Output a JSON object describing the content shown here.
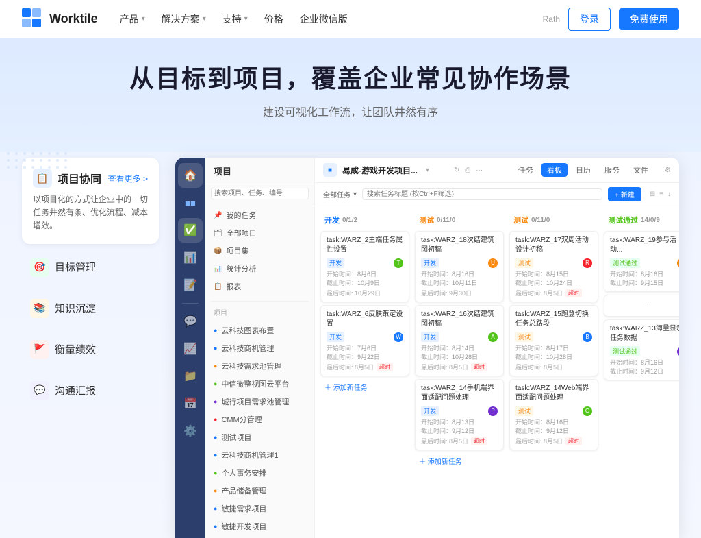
{
  "header": {
    "logo_text": "Worktile",
    "nav": [
      {
        "label": "产品",
        "has_arrow": true
      },
      {
        "label": "解决方案",
        "has_arrow": true
      },
      {
        "label": "支持",
        "has_arrow": true
      },
      {
        "label": "价格",
        "has_arrow": false
      },
      {
        "label": "企业微信版",
        "has_arrow": false
      }
    ],
    "user_email": "Rath",
    "btn_login": "登录",
    "btn_free": "免费使用"
  },
  "hero": {
    "title": "从目标到项目，覆盖企业常见协作场景",
    "subtitle": "建设可视化工作流，让团队井然有序"
  },
  "features": [
    {
      "id": "project",
      "icon": "📋",
      "icon_type": "blue",
      "title": "项目协同",
      "link": "查看更多 >",
      "desc": "以项目化的方式让企业中的一切任务井然有条、优化流程、减本增效。",
      "active": true
    },
    {
      "id": "goal",
      "icon": "🎯",
      "icon_type": "green",
      "title": "目标管理",
      "active": false
    },
    {
      "id": "knowledge",
      "icon": "📚",
      "icon_type": "orange",
      "title": "知识沉淀",
      "active": false
    },
    {
      "id": "performance",
      "icon": "🚩",
      "icon_type": "red",
      "title": "衡量绩效",
      "active": false
    },
    {
      "id": "report",
      "icon": "💬",
      "icon_type": "purple",
      "title": "沟通汇报",
      "active": false
    }
  ],
  "app": {
    "sidebar_icons": [
      "🏠",
      "📁",
      "✅",
      "📊",
      "📝",
      "💬"
    ],
    "left_panel": {
      "title": "项目",
      "search_placeholder": "搜索项目、任务、编号",
      "menu_items": [
        {
          "label": "我的任务",
          "active": false
        },
        {
          "label": "全部项目",
          "active": false
        },
        {
          "label": "项目集",
          "active": false
        },
        {
          "label": "统计分析",
          "active": false
        },
        {
          "label": "报表",
          "active": false
        }
      ],
      "group_label": "项目",
      "projects": [
        {
          "label": "云科技图表布置"
        },
        {
          "label": "云科技商机管理"
        },
        {
          "label": "云科技需求池管理"
        },
        {
          "label": "中信微整视图云平台"
        },
        {
          "label": "城行项目需求池管理"
        },
        {
          "label": "CMM分管理"
        },
        {
          "label": "测试项目"
        },
        {
          "label": "云科技商机管理1"
        },
        {
          "label": "个人事务安排"
        },
        {
          "label": "产品储备管理"
        },
        {
          "label": "敏捷需求项目"
        },
        {
          "label": "敏捷开发项目"
        }
      ]
    },
    "board": {
      "breadcrumb": "易成-游戏开发项目...",
      "tabs": [
        "任务",
        "看板",
        "日历",
        "服务",
        "文件"
      ],
      "active_tab": "看板",
      "filter_label": "全部任务",
      "search_placeholder": "搜索任务标题 (按Ctrl+F筛选)",
      "add_btn": "+ 新建",
      "columns": [
        {
          "title": "开发",
          "count": "0/1/2",
          "color": "blue",
          "cards": [
            {
              "title": "task:WARZ_2主端任务属性设置",
              "tag": "开发",
              "tag_type": "blue",
              "date_label": "开始时间：",
              "date": "8月6日",
              "end_label": "截止时间：",
              "end": "10月9日",
              "bottom_date": "最后时间: 10月29日",
              "avatar_color": "#52c41a"
            },
            {
              "title": "task:WARZ_6皮肤策定设置",
              "tag": "开发",
              "tag_type": "blue",
              "date_label": "开始时间：",
              "date": "7月6日",
              "end_label": "截止时间：",
              "end": "9月22日",
              "bottom_date": "最后时间: 8月5日",
              "bottom_tag": "超时",
              "avatar_color": "#1677ff"
            }
          ]
        },
        {
          "title": "测试",
          "count": "0/11/0",
          "color": "orange",
          "cards": [
            {
              "title": "task:WARZ_18次结建筑图初稿",
              "tag": "开发",
              "tag_type": "blue",
              "date_label": "开始时间：",
              "date": "8月16日",
              "end_label": "截止时间：",
              "end": "10月11日",
              "bottom_date": "最后时间: 9月30日",
              "avatar_color": "#fa8c16"
            },
            {
              "title": "task:WARZ_16次结建筑图初稿",
              "tag": "开发",
              "tag_type": "blue",
              "date_label": "开始时间：",
              "date": "8月14日",
              "end_label": "截止时间：",
              "end": "10月28日",
              "bottom_date": "最后时间: 8月5日",
              "bottom_tag": "超时",
              "avatar_color": "#52c41a"
            },
            {
              "title": "task:WARZ_14手机端界面适配问题处理",
              "tag": "开发",
              "tag_type": "blue",
              "date_label": "开始时间：",
              "date": "8月13日",
              "end_label": "截止时间：",
              "end": "9月12日",
              "bottom_date": "最后时间: 8月5日",
              "bottom_tag": "超时",
              "avatar_color": "#722ed1"
            }
          ]
        },
        {
          "title": "测试",
          "count": "0/11/0",
          "color": "orange",
          "cards": [
            {
              "title": "task:WARZ_17双周活动设计初稿",
              "tag": "测试",
              "tag_type": "orange",
              "date_label": "开始时间：",
              "date": "8月15日",
              "end_label": "截止时间：",
              "end": "10月24日",
              "bottom_date": "最后时间: 8月5日",
              "bottom_tag": "超时",
              "avatar_color": "#f5222d"
            },
            {
              "title": "task:WARZ_15跑登切换任务总路段",
              "tag": "测试",
              "tag_type": "orange",
              "date_label": "开始时间：",
              "date": "8月17日",
              "end_label": "截止时间：",
              "end": "10月28日",
              "bottom_date": "最后时间: 8月5日",
              "avatar_color": "#1677ff"
            },
            {
              "title": "task:WARZ_14Web端界面适配问题处理",
              "tag": "测试",
              "tag_type": "orange",
              "date_label": "开始时间：",
              "date": "8月16日",
              "end_label": "截止时间：",
              "end": "9月12日",
              "bottom_date": "最后时间: 8月5日",
              "bottom_tag": "超时",
              "avatar_color": "#52c41a"
            }
          ]
        },
        {
          "title": "测试通过",
          "count": "14/0/9",
          "color": "green",
          "cards": [
            {
              "title": "task:WARZ_19参与活动...",
              "tag": "测试通过",
              "tag_type": "green",
              "date_label": "开始时间：",
              "date": "8月16日",
              "end_label": "截止时间：",
              "end": "9月15日",
              "avatar_color": "#fa8c16"
            },
            {
              "title": "...",
              "avatar_color": "#1677ff"
            },
            {
              "title": "task:WARZ_13海量显示任务数据",
              "tag": "测试通过",
              "tag_type": "green",
              "date_label": "开始时间：",
              "date": "8月16日",
              "end_label": "截止时间：",
              "end": "9月12日",
              "avatar_color": "#722ed1"
            }
          ]
        }
      ]
    }
  }
}
